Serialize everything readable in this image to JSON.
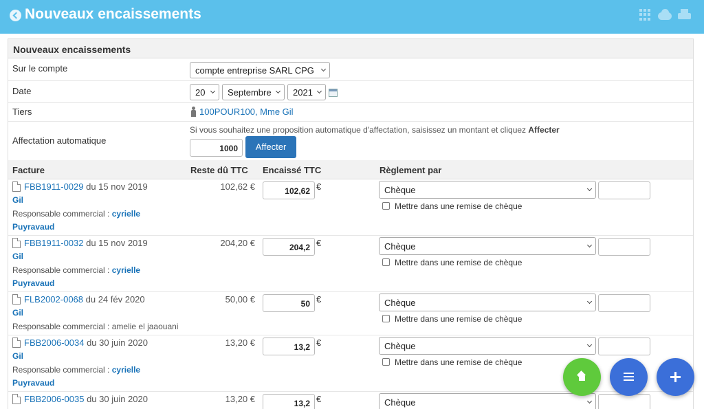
{
  "header": {
    "title": "Nouveaux encaissements",
    "back_icon": "circle-chevron-left-icon",
    "right_icons": [
      "grid-icon",
      "cloud-download-icon",
      "print-icon"
    ],
    "color": "#5bc0eb"
  },
  "panel": {
    "title": "Nouveaux encaissements"
  },
  "form": {
    "account_label": "Sur le compte",
    "account_value": "compte entreprise SARL CPG",
    "date_label": "Date",
    "date_day": "20",
    "date_month": "Septembre",
    "date_year": "2021",
    "tiers_label": "Tiers",
    "tiers_value": "100POUR100, Mme Gil",
    "auto_label": "Affectation automatique",
    "auto_hint_prefix": "Si vous souhaitez une proposition automatique d'affectation, saisissez un montant et cliquez ",
    "auto_hint_bold": "Affecter",
    "auto_amount": "1000",
    "auto_button": "Affecter"
  },
  "table": {
    "headers": {
      "facture": "Facture",
      "reste": "Reste dû TTC",
      "encaisse": "Encaissé TTC",
      "reglement": "Règlement par"
    },
    "currency": "€",
    "checkbox_label": "Mettre dans une remise de chèque",
    "rows": [
      {
        "ref": "FBB1911-0029",
        "date_text": " du 15 nov 2019",
        "tiers": "Gil",
        "resp_prefix": "Responsable commercial : ",
        "resp_first": "cyrielle",
        "resp_last": "Puyravaud",
        "reste": "102,62 €",
        "encaisse": "102,62",
        "reglement": "Chèque"
      },
      {
        "ref": "FBB1911-0032",
        "date_text": " du 15 nov 2019",
        "tiers": "Gil",
        "resp_prefix": "Responsable commercial : ",
        "resp_first": "cyrielle",
        "resp_last": "Puyravaud",
        "reste": "204,20 €",
        "encaisse": "204,2",
        "reglement": "Chèque"
      },
      {
        "ref": "FLB2002-0068",
        "date_text": " du 24 fév 2020",
        "tiers": "Gil",
        "resp_prefix": "Responsable commercial : amelie el jaaouani",
        "reste": "50,00 €",
        "encaisse": "50",
        "reglement": "Chèque"
      },
      {
        "ref": "FBB2006-0034",
        "date_text": " du 30 juin 2020",
        "tiers": "Gil",
        "resp_prefix": "Responsable commercial : ",
        "resp_first": "cyrielle",
        "resp_last": "Puyravaud",
        "reste": "13,20 €",
        "encaisse": "13,2",
        "reglement": "Chèque"
      },
      {
        "ref": "FBB2006-0035",
        "date_text": " du 30 juin 2020",
        "reste": "13,20 €",
        "encaisse": "13,2",
        "reglement": "Chèque"
      }
    ]
  },
  "fabs": [
    "home-icon",
    "menu-icon",
    "plus-icon"
  ]
}
